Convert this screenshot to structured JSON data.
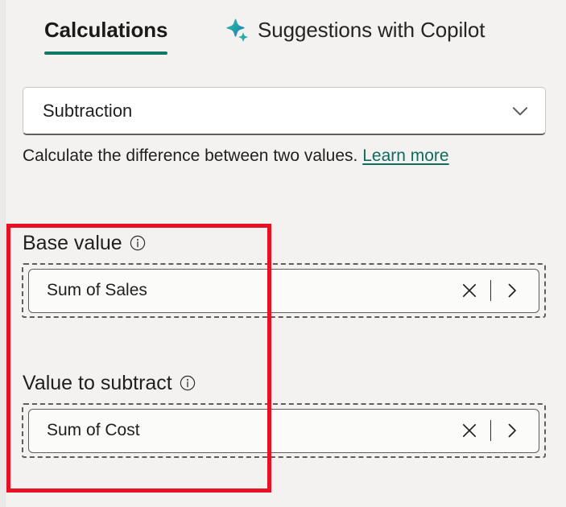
{
  "window": {
    "background_color": "#f3f2f1"
  },
  "tabs": {
    "items": [
      {
        "id": "calculations",
        "label": "Calculations",
        "selected": true,
        "icon": null
      },
      {
        "id": "suggestions",
        "label": "Suggestions with Copilot",
        "selected": false,
        "icon": "copilot-sparkle-icon"
      }
    ],
    "active_underline_color": "#117865"
  },
  "calculation_type": {
    "selected": "Subtraction",
    "placeholder": "Select a calculation",
    "chevron_icon": "chevron-down-icon"
  },
  "description": {
    "text": "Calculate the difference between two values.",
    "link_label": "Learn more",
    "link_color": "#0f6c5e"
  },
  "fields": [
    {
      "id": "base-value",
      "label": "Base value",
      "info_icon": "info-circle-icon",
      "value": "Sum of Sales",
      "placeholder": "Drag a field here",
      "clear_icon": "close-icon",
      "expand_icon": "chevron-right-icon"
    },
    {
      "id": "value-to-subtract",
      "label": "Value to subtract",
      "info_icon": "info-circle-icon",
      "value": "Sum of Cost",
      "placeholder": "Drag a field here",
      "clear_icon": "close-icon",
      "expand_icon": "chevron-right-icon"
    }
  ],
  "annotation": {
    "type": "highlight-rectangle",
    "color": "#e81123"
  }
}
